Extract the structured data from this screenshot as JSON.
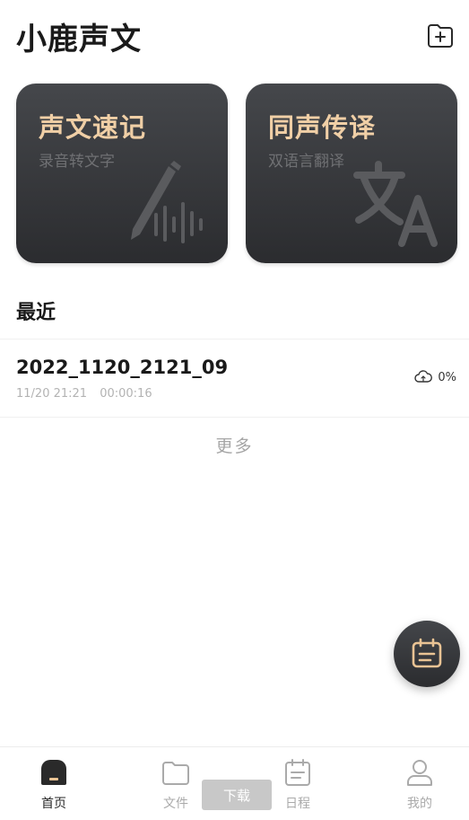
{
  "header": {
    "title": "小鹿声文",
    "new_folder_icon": "folder-plus-icon"
  },
  "cards": [
    {
      "title": "声文速记",
      "subtitle": "录音转文字",
      "icon": "pen-waveform-icon"
    },
    {
      "title": "同声传译",
      "subtitle": "双语言翻译",
      "icon": "translate-icon"
    }
  ],
  "recent": {
    "title": "最近",
    "items": [
      {
        "name": "2022_1120_2121_09",
        "date": "11/20 21:21",
        "duration": "00:00:16",
        "sync_status": "0%",
        "sync_icon": "cloud-icon"
      }
    ],
    "more_label": "更多"
  },
  "fab": {
    "icon": "calendar-note-icon"
  },
  "tabbar": {
    "tabs": [
      {
        "label": "首页",
        "icon": "home-icon",
        "active": true
      },
      {
        "label": "文件",
        "icon": "folder-icon",
        "active": false
      },
      {
        "label": "日程",
        "icon": "calendar-icon",
        "active": false
      },
      {
        "label": "我的",
        "icon": "user-icon",
        "active": false
      }
    ]
  },
  "toast": {
    "label": "下载"
  },
  "colors": {
    "card_title": "#f0cfa6",
    "card_bg": "#2b2c2f",
    "accent": "#f0cfa6"
  }
}
